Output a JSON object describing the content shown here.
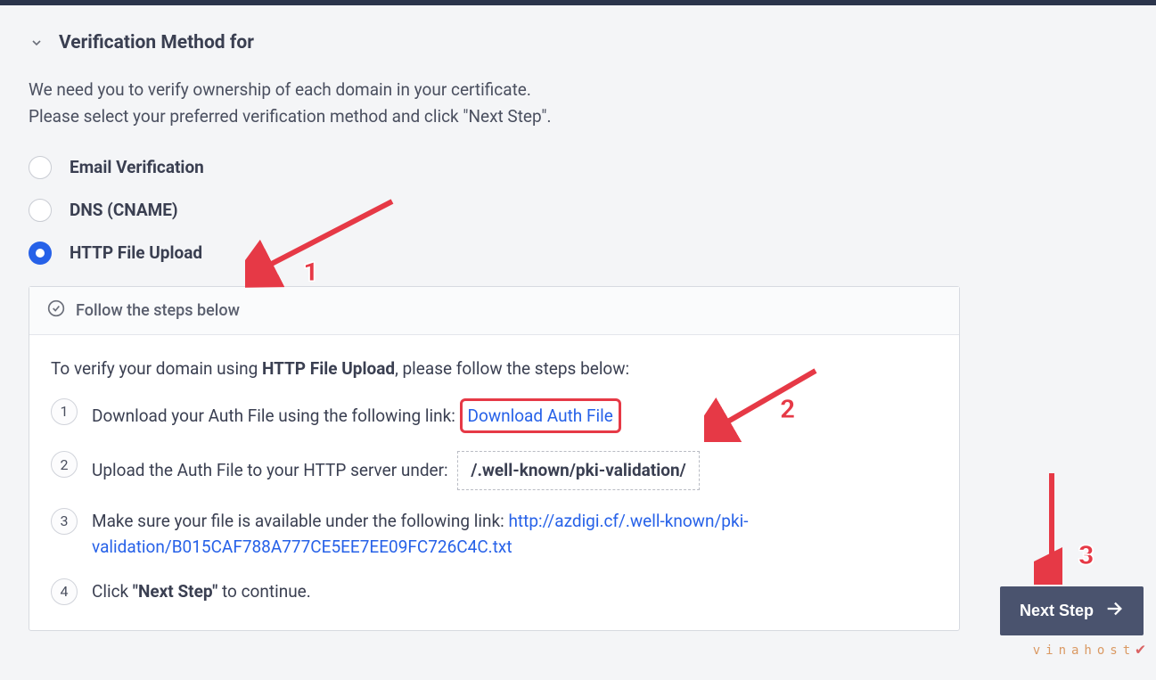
{
  "header": {
    "title": "Verification Method for"
  },
  "intro": {
    "line1": "We need you to verify ownership of each domain in your certificate.",
    "line2": "Please select your preferred verification method and click \"Next Step\"."
  },
  "options": {
    "email": "Email Verification",
    "dns": "DNS (CNAME)",
    "http": "HTTP File Upload"
  },
  "steps_card": {
    "header": "Follow the steps below",
    "intro_pre": "To verify your domain using ",
    "intro_bold": "HTTP File Upload",
    "intro_post": ", please follow the steps below:",
    "step1": {
      "num": "1",
      "text": "Download your Auth File using the following link: ",
      "link": "Download Auth File"
    },
    "step2": {
      "num": "2",
      "text": "Upload the Auth File to your HTTP server under:",
      "path": "/.well-known/pki-validation/"
    },
    "step3": {
      "num": "3",
      "text": "Make sure your file is available under the following link: ",
      "link": "http://azdigi.cf/.well-known/pki-validation/B015CAF788A777CE5EE7EE09FC726C4C.txt"
    },
    "step4": {
      "num": "4",
      "pre": "Click ",
      "bold": "\"Next Step\"",
      "post": " to continue."
    }
  },
  "next_button": "Next Step",
  "annotations": {
    "n1": "1",
    "n2": "2",
    "n3": "3"
  },
  "watermark": "vinahost"
}
